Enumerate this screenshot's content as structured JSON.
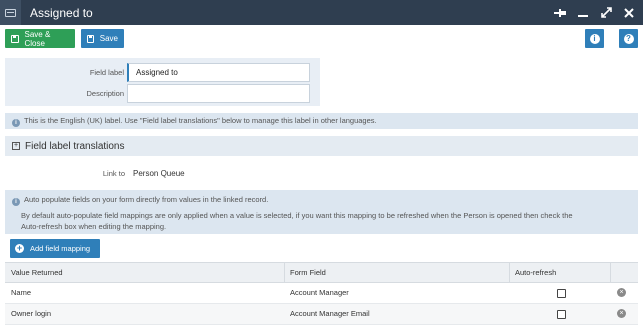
{
  "window": {
    "title": "Assigned to",
    "app_icon": "form-icon",
    "controls": [
      "pin-icon",
      "minimize-icon",
      "maximize-icon",
      "close-icon"
    ]
  },
  "toolbar": {
    "save_close_label": "Save & Close",
    "save_label": "Save",
    "info_icon": "info-icon",
    "help_icon": "help-icon",
    "accent_green": "#2e9f57",
    "accent_blue": "#2f7fb9"
  },
  "field_panel": {
    "field_label_caption": "Field label",
    "field_label_value": "Assigned to",
    "description_caption": "Description",
    "description_value": ""
  },
  "info_label": {
    "text": "This is the English (UK) label. Use \"Field label translations\" below to manage this label in other languages."
  },
  "translations_section": {
    "title": "Field label translations"
  },
  "link": {
    "caption": "Link to",
    "value": "Person Queue"
  },
  "info_autopopulate": {
    "line1": "Auto populate fields on your form directly from values in the linked record.",
    "line2": "By default auto-populate field mappings are only applied when a value is selected, if you want this mapping to be refreshed when the Person is opened then check the",
    "line3": "Auto-refresh box when editing the mapping."
  },
  "add_mapping_label": "Add field mapping",
  "grid": {
    "headers": {
      "value_returned": "Value Returned",
      "form_field": "Form Field",
      "auto_refresh": "Auto-refresh"
    },
    "rows": [
      {
        "value_returned": "Name",
        "form_field": "Account Manager",
        "auto_refresh": false
      },
      {
        "value_returned": "Owner login",
        "form_field": "Account Manager Email",
        "auto_refresh": false
      }
    ]
  }
}
